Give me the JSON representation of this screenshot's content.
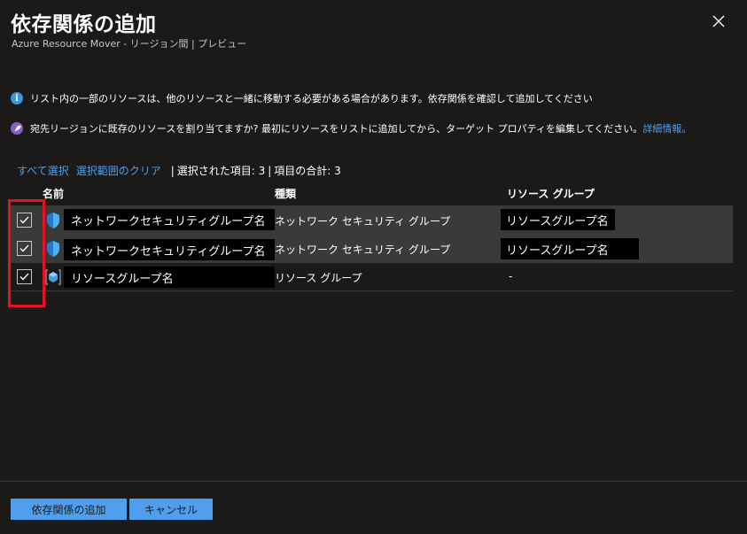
{
  "header": {
    "title": "依存関係の追加",
    "subtitle": "Azure Resource Mover - リージョン間 | プレビュー"
  },
  "notices": {
    "info_text": "リスト内の一部のリソースは、他のリソースと一緒に移動する必要がある場合があります。依存関係を確認して追加してください",
    "tip_text": "宛先リージョンに既存のリソースを割り当てますか? 最初にリソースをリストに追加してから、ターゲット プロパティを編集してください。",
    "tip_link": "詳細情報。"
  },
  "toolbar": {
    "select_all": "すべて選択",
    "clear_selection": "選択範囲のクリア",
    "selected_count": "選択された項目: 3",
    "total_count": "項目の合計: 3"
  },
  "grid": {
    "columns": [
      "名前",
      "種類",
      "リソース グループ"
    ],
    "rows": [
      {
        "name": "ネットワークセキュリティグループ名",
        "type": "ネットワーク セキュリティ グループ",
        "resource_group": "リソースグループ名",
        "checked": true,
        "icon": "shield-icon"
      },
      {
        "name": "ネットワークセキュリティグループ名",
        "type": "ネットワーク セキュリティ グループ",
        "resource_group": "リソースグループ名",
        "checked": true,
        "icon": "shield-icon"
      },
      {
        "name": "リソースグループ名",
        "type": "リソース グループ",
        "resource_group": "-",
        "checked": true,
        "icon": "resource-group-icon"
      }
    ]
  },
  "footer": {
    "add_label": "依存関係の追加",
    "cancel_label": "キャンセル"
  },
  "colors": {
    "background": "#1b1a19",
    "accent": "#4f9fee",
    "highlight": "#e81123"
  }
}
